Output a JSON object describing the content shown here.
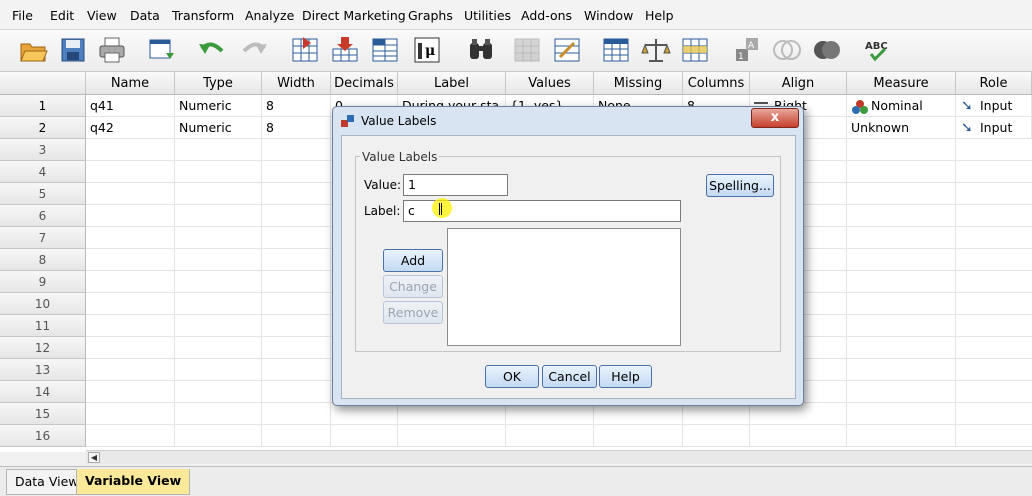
{
  "menu": [
    "File",
    "Edit",
    "View",
    "Data",
    "Transform",
    "Analyze",
    "Direct Marketing",
    "Graphs",
    "Utilities",
    "Add-ons",
    "Window",
    "Help"
  ],
  "toolbar": {
    "icons": [
      "open-folder-icon",
      "save-icon",
      "print-icon",
      "dialog-recall-icon",
      "undo-icon",
      "redo-icon",
      "go-to-case-icon",
      "go-to-variable-icon",
      "variables-icon",
      "descriptives-icon",
      "find-icon",
      "insert-cases-icon",
      "insert-variable-icon",
      "split-file-icon",
      "weight-cases-icon",
      "select-cases-icon",
      "value-labels-icon",
      "use-sets-icon",
      "show-all-variables-icon",
      "spell-check-icon"
    ]
  },
  "grid": {
    "columns": [
      "Name",
      "Type",
      "Width",
      "Decimals",
      "Label",
      "Values",
      "Missing",
      "Columns",
      "Align",
      "Measure",
      "Role"
    ],
    "row_numbers": [
      "1",
      "2",
      "3",
      "4",
      "5",
      "6",
      "7",
      "8",
      "9",
      "10",
      "11",
      "12",
      "13",
      "14",
      "15",
      "16"
    ],
    "rows": [
      {
        "name": "q41",
        "type": "Numeric",
        "width": "8",
        "decimals": "0",
        "label": "During your sta",
        "values": "{1, yes}",
        "missing": "None",
        "columns": "8",
        "align": "Right",
        "measure": "Nominal",
        "role": "Input"
      },
      {
        "name": "q42",
        "type": "Numeric",
        "width": "8",
        "decimals": "",
        "label": "",
        "values": "",
        "missing": "",
        "columns": "",
        "align": "",
        "measure": "Unknown",
        "role": "Input"
      }
    ]
  },
  "tabs": {
    "data_view": "Data View",
    "variable_view": "Variable View"
  },
  "dialog": {
    "title": "Value Labels",
    "close": "x",
    "group_title": "Value Labels",
    "value_label": "Value:",
    "value": "1",
    "label_label": "Label:",
    "label_value": "c",
    "spelling": "Spelling...",
    "add": "Add",
    "change": "Change",
    "remove": "Remove",
    "ok": "OK",
    "cancel": "Cancel",
    "help": "Help"
  }
}
